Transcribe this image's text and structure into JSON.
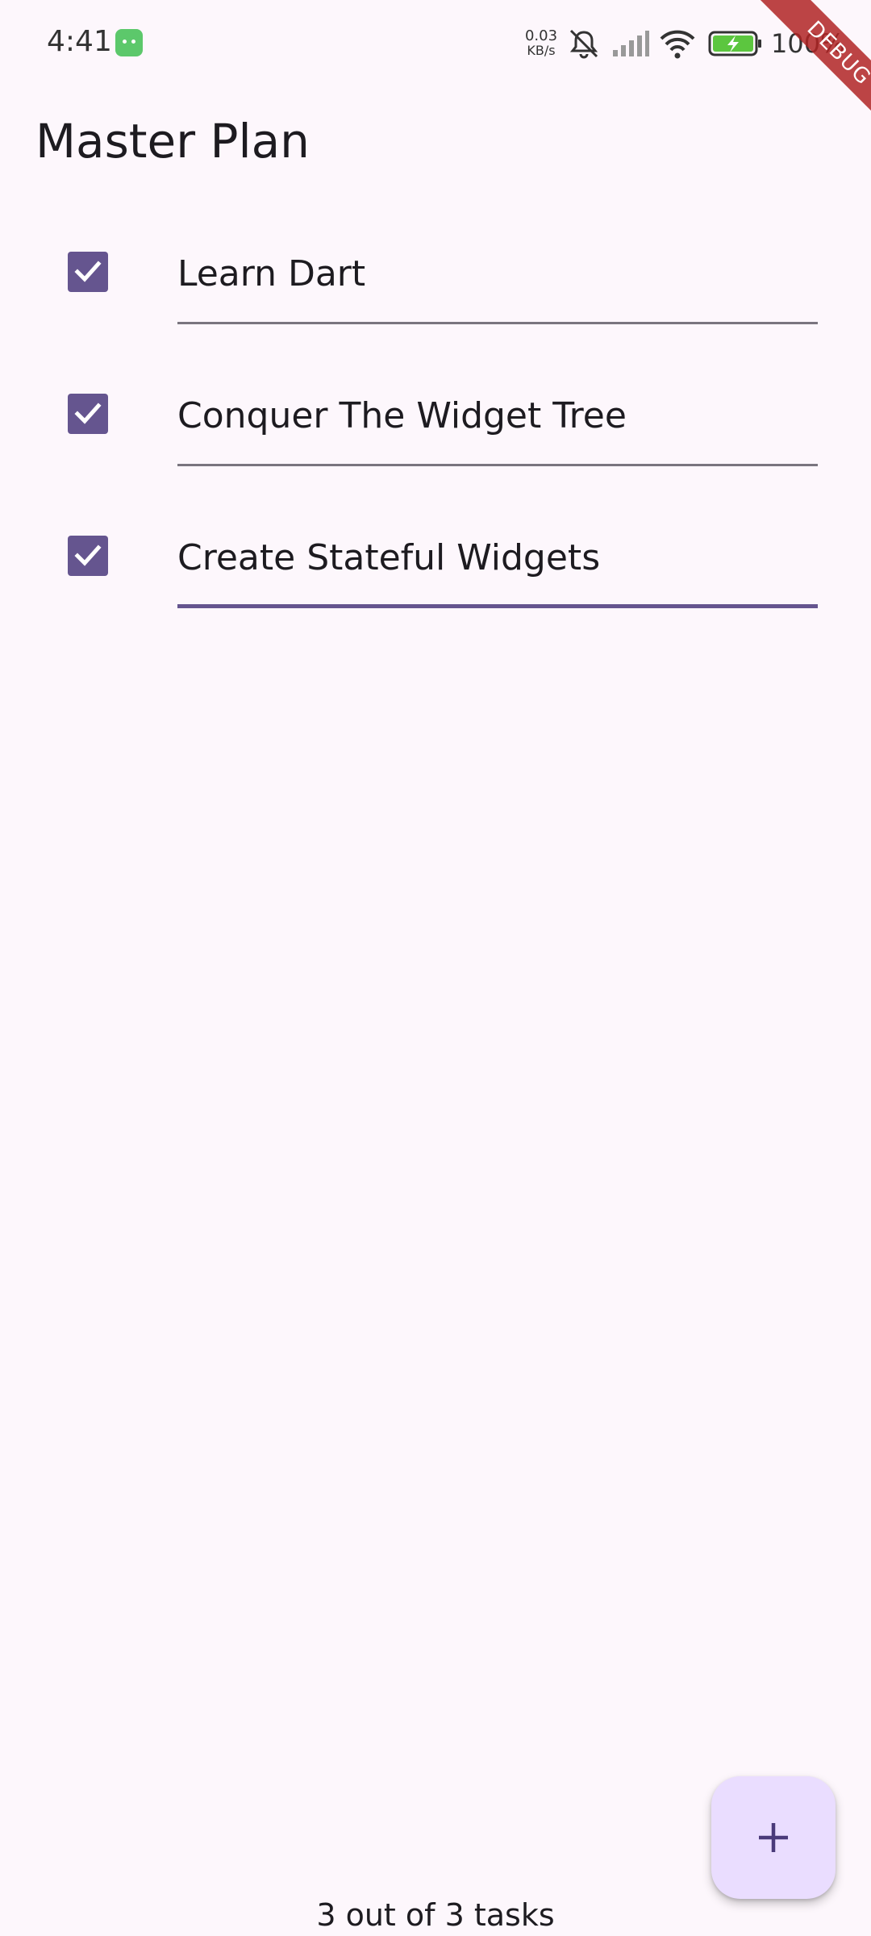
{
  "status_bar": {
    "time": "4:41",
    "net_speed_value": "0.03",
    "net_speed_unit": "KB/s",
    "battery": "100%"
  },
  "debug_banner": "DEBUG",
  "app_bar": {
    "title": "Master Plan"
  },
  "tasks": [
    {
      "description": "Learn Dart",
      "complete": true
    },
    {
      "description": "Conquer The Widget Tree",
      "complete": true
    },
    {
      "description": "Create Stateful Widgets",
      "complete": true
    }
  ],
  "footer": {
    "summary": "3 out of 3 tasks"
  },
  "colors": {
    "primary": "#65558f",
    "background": "#fdf7fc",
    "fab_background": "#eaddff",
    "underline": "#7a757f"
  },
  "icons": {
    "fab": "plus-icon",
    "checkbox": "check-icon"
  }
}
